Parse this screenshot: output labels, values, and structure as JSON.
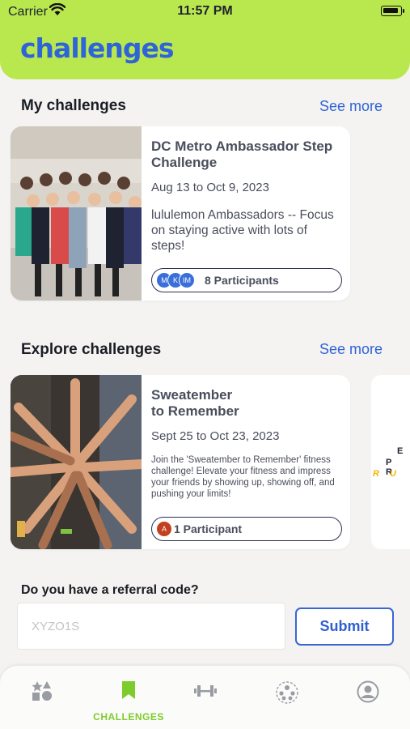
{
  "status": {
    "carrier": "Carrier",
    "time": "11:57 PM"
  },
  "app": {
    "logo": "challenges",
    "accent": "#b9e74e",
    "link_color": "#2f63d6"
  },
  "my_challenges": {
    "title": "My challenges",
    "see_more": "See more",
    "cards": [
      {
        "name": "DC Metro Ambassador Step Challenge",
        "dates": "Aug 13 to Oct 9, 2023",
        "description": "lululemon Ambassadors -- Focus on staying active with lots of steps!",
        "avatars": [
          "M",
          "K",
          "IM"
        ],
        "participants": "8 Participants"
      }
    ]
  },
  "explore_challenges": {
    "title": "Explore challenges",
    "see_more": "See more",
    "cards": [
      {
        "name": "Sweatember to Remember",
        "dates": "Sept 25 to Oct 23, 2023",
        "description": "Join the 'Sweatember to Remember' fitness challenge! Elevate your fitness and impress your friends by showing up, showing off, and pushing your limits!",
        "avatars": [
          "A"
        ],
        "participants": "1 Participant"
      }
    ],
    "peek_card_text": [
      "E",
      "P R",
      "R U"
    ]
  },
  "referral": {
    "label": "Do you have a referral code?",
    "placeholder": "XYZO1S",
    "submit": "Submit"
  },
  "tabbar": {
    "items": [
      {
        "icon": "shapes-icon",
        "label": ""
      },
      {
        "icon": "bookmark-icon",
        "label": "CHALLENGES",
        "active": true
      },
      {
        "icon": "dumbbell-icon",
        "label": ""
      },
      {
        "icon": "community-icon",
        "label": ""
      },
      {
        "icon": "profile-icon",
        "label": ""
      }
    ]
  }
}
